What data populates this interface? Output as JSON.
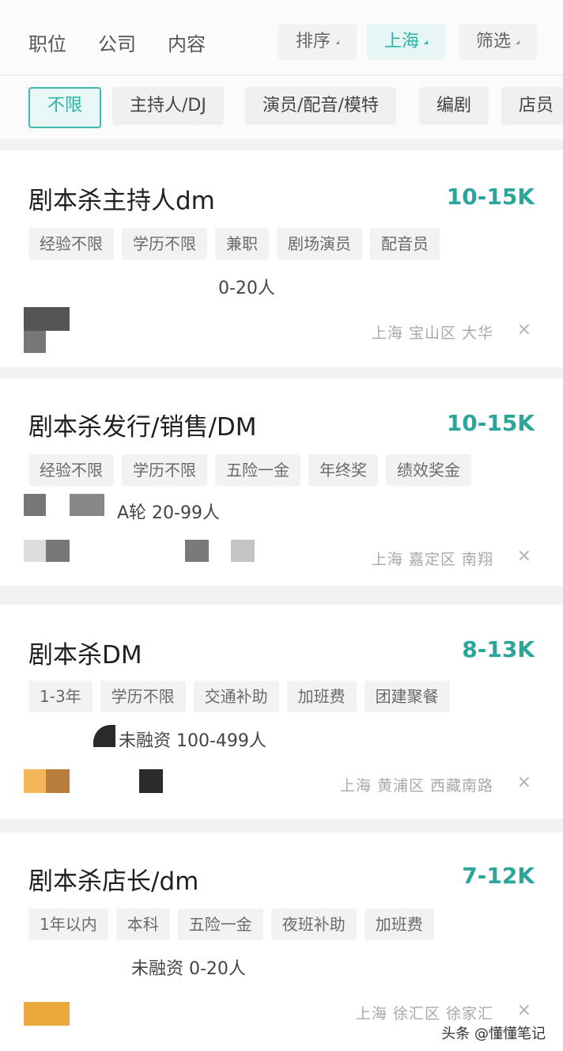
{
  "top_tabs": [
    "职位",
    "公司",
    "内容"
  ],
  "filters": {
    "sort": "排序",
    "city": "上海",
    "screen": "筛选"
  },
  "categories": [
    "不限",
    "主持人/DJ",
    "演员/配音/模特",
    "编剧",
    "店员"
  ],
  "colors": {
    "accent": "#2bb3a7",
    "salary": "#2aa69a"
  },
  "jobs": [
    {
      "title": "剧本杀主持人dm",
      "salary": "10-15K",
      "tags": [
        "经验不限",
        "学历不限",
        "兼职",
        "剧场演员",
        "配音员"
      ],
      "company_info": "0-20人",
      "location": "上海  宝山区  大华"
    },
    {
      "title": "剧本杀发行/销售/DM",
      "salary": "10-15K",
      "tags": [
        "经验不限",
        "学历不限",
        "五险一金",
        "年终奖",
        "绩效奖金"
      ],
      "company_info": "A轮  20-99人",
      "location": "上海  嘉定区  南翔"
    },
    {
      "title": "剧本杀DM",
      "salary": "8-13K",
      "tags": [
        "1-3年",
        "学历不限",
        "交通补助",
        "加班费",
        "团建聚餐"
      ],
      "company_info": "未融资  100-499人",
      "location": "上海  黄浦区  西藏南路"
    },
    {
      "title": "剧本杀店长/dm",
      "salary": "7-12K",
      "tags": [
        "1年以内",
        "本科",
        "五险一金",
        "夜班补助",
        "加班费"
      ],
      "company_info": "未融资  0-20人",
      "location": "上海  徐汇区  徐家汇"
    }
  ],
  "close_glyph": "×",
  "watermark": "头条 @懂懂笔记"
}
